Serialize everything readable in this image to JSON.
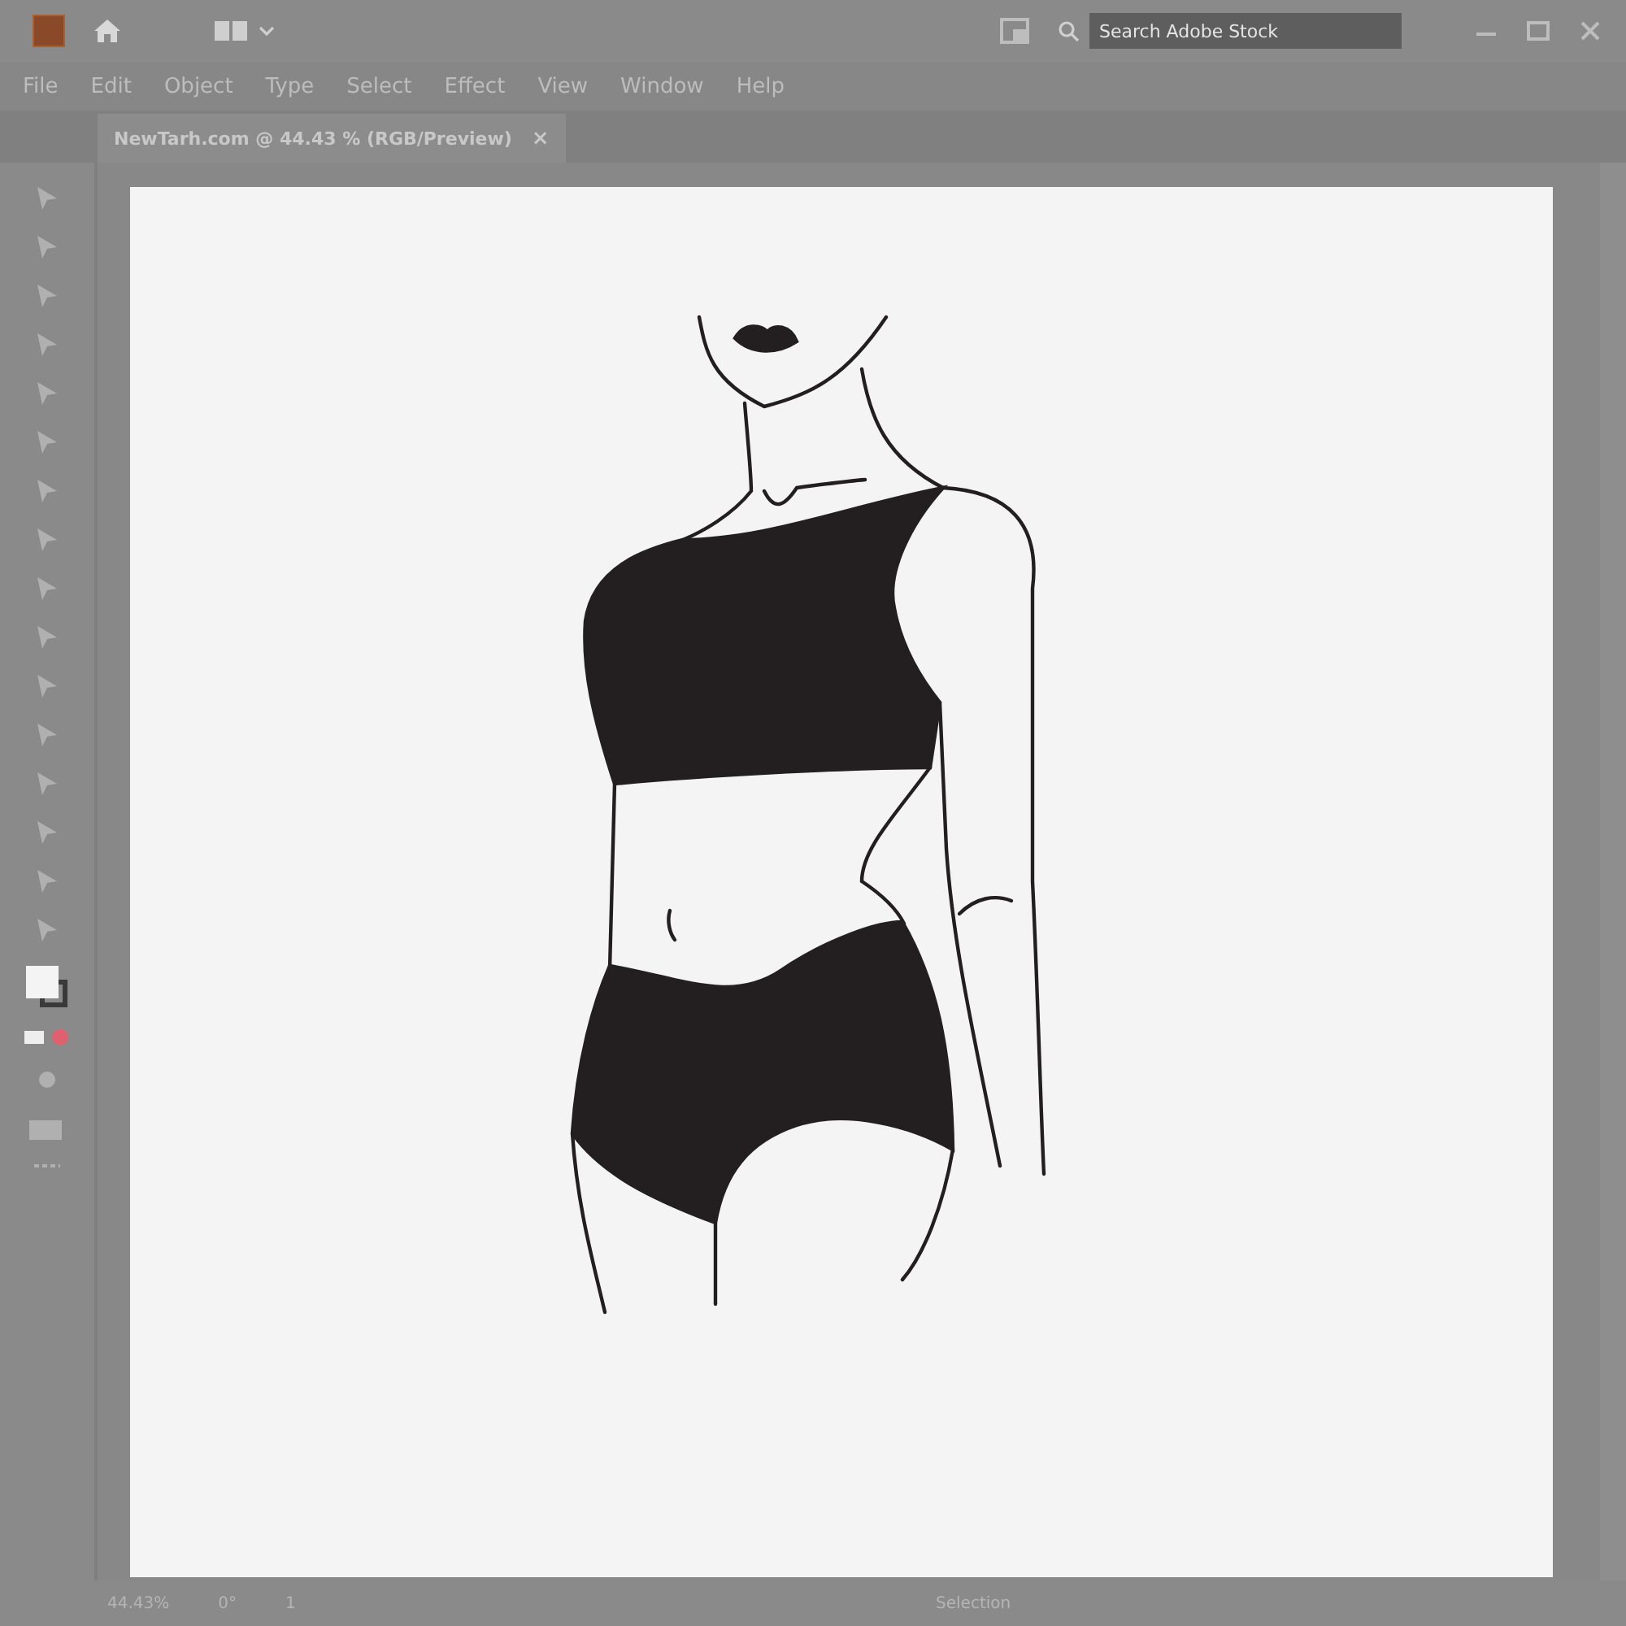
{
  "menu": [
    "File",
    "Edit",
    "Object",
    "Type",
    "Select",
    "Effect",
    "View",
    "Window",
    "Help"
  ],
  "search": {
    "placeholder": "Search Adobe Stock"
  },
  "document_tab": {
    "title": "NewTarh.com @ 44.43 % (RGB/Preview)",
    "close": "×"
  },
  "status_bar": {
    "zoom": "44.43%",
    "rotation": "0°",
    "artboard": "1",
    "tool": "Selection"
  }
}
